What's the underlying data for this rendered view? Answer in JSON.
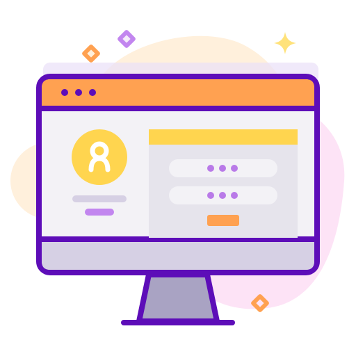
{
  "illustration": {
    "subject": "computer-monitor-login-screen",
    "icons": [
      "diamond-sparkle-icon",
      "plus-sparkle-icon",
      "user-avatar-icon",
      "password-dots-icon"
    ]
  },
  "colors": {
    "outline": "#5d0db8",
    "title_bar": "#ffa151",
    "avatar": "#ffd54f",
    "form_header": "#ffd54f",
    "submit_button": "#ffa151",
    "dots": "#b97ae8",
    "bezel": "#d6d0e4",
    "stand": "#a9a3c3",
    "screen": "#f3f2f6",
    "panel": "#e6e4ec",
    "blob_orange": "#fff0dc",
    "blob_pink": "#fde3f6"
  },
  "login_form": {
    "fields": [
      {
        "kind": "masked",
        "dot_count": 3
      },
      {
        "kind": "masked",
        "dot_count": 3
      }
    ]
  }
}
